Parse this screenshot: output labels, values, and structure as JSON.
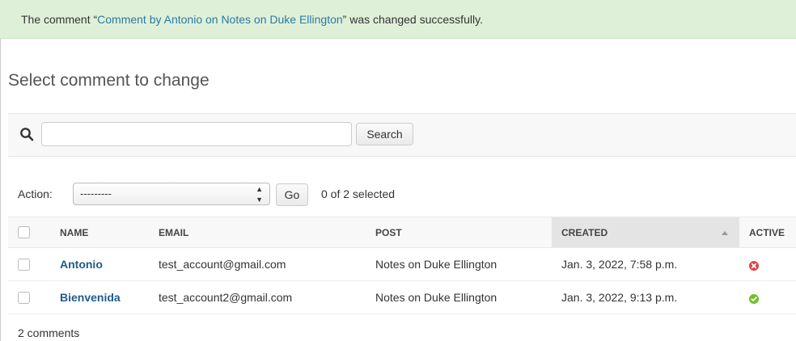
{
  "message": {
    "prefix": "The comment “",
    "link": "Comment by Antonio on Notes on Duke Ellington",
    "suffix": "” was changed successfully."
  },
  "page_title": "Select comment to change",
  "search": {
    "value": "",
    "button_label": "Search"
  },
  "actions": {
    "label": "Action:",
    "selected_option": "---------",
    "go_label": "Go",
    "selection_count": "0 of 2 selected"
  },
  "table": {
    "headers": {
      "name": "Name",
      "email": "Email",
      "post": "Post",
      "created": "Created",
      "active": "Active"
    },
    "rows": [
      {
        "name": "Antonio",
        "email": "test_account@gmail.com",
        "post": "Notes on Duke Ellington",
        "created": "Jan. 3, 2022, 7:58 p.m.",
        "active": "no"
      },
      {
        "name": "Bienvenida",
        "email": "test_account2@gmail.com",
        "post": "Notes on Duke Ellington",
        "created": "Jan. 3, 2022, 9:13 p.m.",
        "active": "yes"
      }
    ]
  },
  "paginator": "2 comments",
  "colors": {
    "success_bg": "#dff0d8",
    "link": "#1e5c8c",
    "inactive_icon": "#dd4646",
    "active_icon": "#70bf2b"
  },
  "icons": {
    "search": "search-icon",
    "inactive": "x-circle-icon",
    "active": "check-circle-icon"
  }
}
